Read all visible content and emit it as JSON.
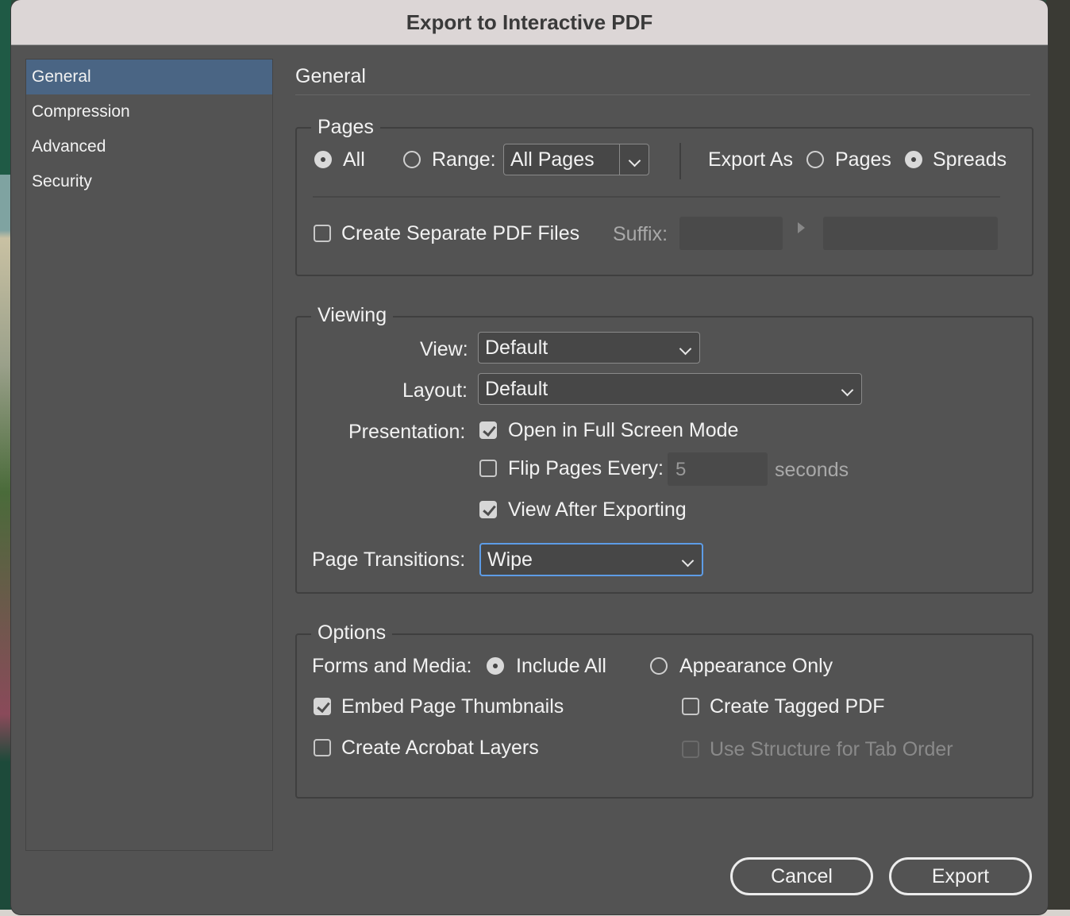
{
  "dialog": {
    "title": "Export to Interactive PDF"
  },
  "nav": {
    "items": [
      "General",
      "Compression",
      "Advanced",
      "Security"
    ],
    "active": "General"
  },
  "section": {
    "title": "General"
  },
  "pages": {
    "legend": "Pages",
    "all_label": "All",
    "range_label": "Range:",
    "range_value": "All Pages",
    "export_as_label": "Export As",
    "pages_label": "Pages",
    "spreads_label": "Spreads",
    "selected_scope": "All",
    "selected_export_as": "Spreads",
    "create_separate_label": "Create Separate PDF Files",
    "create_separate_checked": false,
    "suffix_label": "Suffix:"
  },
  "viewing": {
    "legend": "Viewing",
    "view_label": "View:",
    "view_value": "Default",
    "layout_label": "Layout:",
    "layout_value": "Default",
    "presentation_label": "Presentation:",
    "full_screen_label": "Open in Full Screen Mode",
    "full_screen_checked": true,
    "flip_pages_label": "Flip Pages Every:",
    "flip_pages_checked": false,
    "flip_pages_value": "5",
    "seconds_label": "seconds",
    "view_after_label": "View After Exporting",
    "view_after_checked": true,
    "transitions_label": "Page Transitions:",
    "transitions_value": "Wipe"
  },
  "options": {
    "legend": "Options",
    "forms_media_label": "Forms and Media:",
    "include_all_label": "Include All",
    "appearance_only_label": "Appearance Only",
    "forms_media_selected": "Include All",
    "embed_thumbnails_label": "Embed Page Thumbnails",
    "embed_thumbnails_checked": true,
    "create_tagged_label": "Create Tagged PDF",
    "create_tagged_checked": false,
    "acrobat_layers_label": "Create Acrobat Layers",
    "acrobat_layers_checked": false,
    "tab_order_label": "Use Structure for Tab Order",
    "tab_order_checked": false
  },
  "buttons": {
    "cancel": "Cancel",
    "export": "Export"
  },
  "colors": {
    "dialog_bg": "#535353",
    "accent": "#4a6584",
    "focus": "#5d9ce6",
    "titlebar": "#dcd6d6"
  }
}
